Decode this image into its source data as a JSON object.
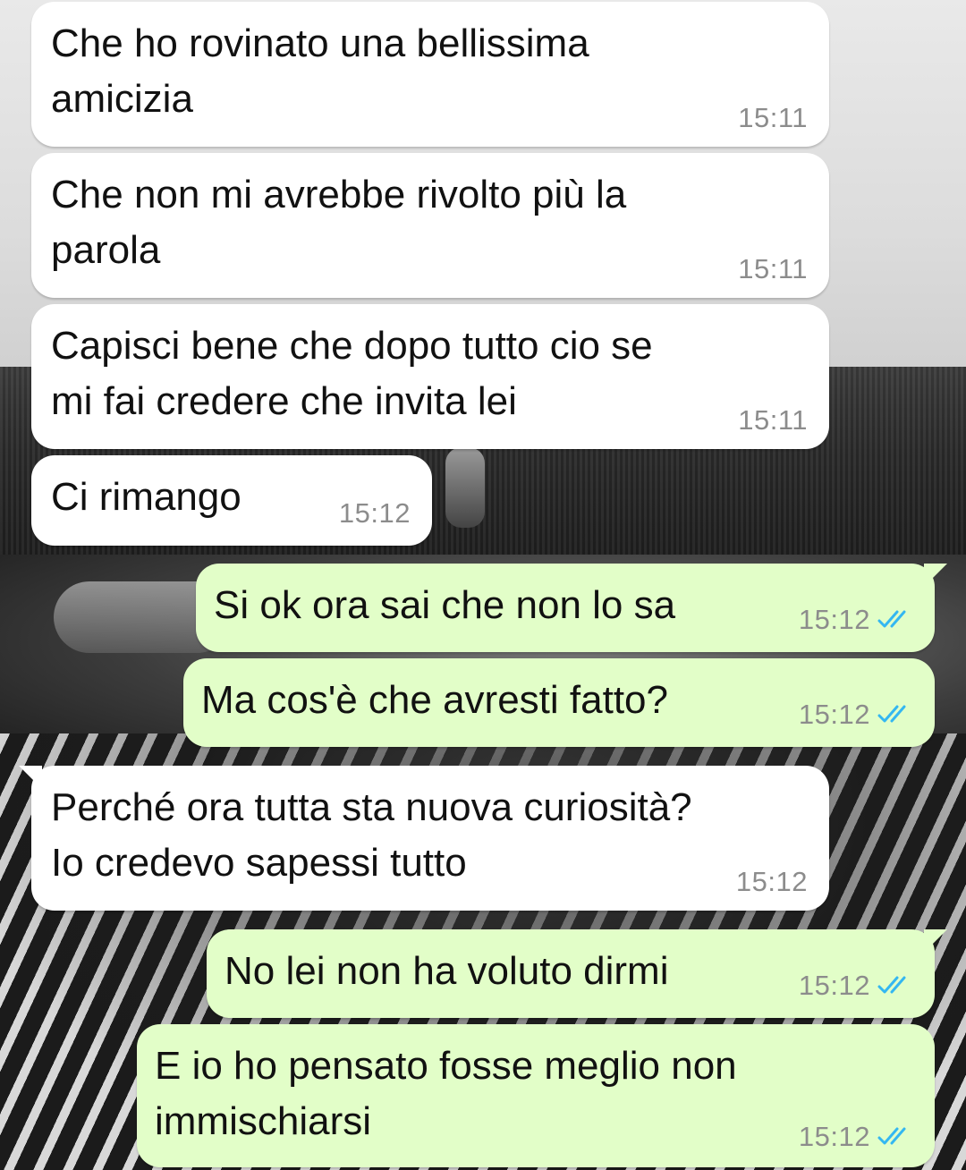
{
  "colors": {
    "incoming_bubble": "#ffffff",
    "outgoing_bubble": "#e2fec8",
    "text": "#111111",
    "timestamp": "#8c8c8c",
    "read_ticks": "#34b7f1"
  },
  "messages": [
    {
      "direction": "in",
      "text": "Che ho rovinato una bellissima\namicizia",
      "time": "15:11"
    },
    {
      "direction": "in",
      "text": "Che non mi avrebbe rivolto più la\nparola",
      "time": "15:11"
    },
    {
      "direction": "in",
      "text": "Capisci bene che dopo tutto cio se\nmi fai credere che invita lei",
      "time": "15:11"
    },
    {
      "direction": "in",
      "text": "Ci rimango",
      "time": "15:12"
    },
    {
      "direction": "out",
      "text": "Si ok ora sai che non lo sa",
      "time": "15:12",
      "status_icon": "double-check-read-icon"
    },
    {
      "direction": "out",
      "text": "Ma cos'è che avresti fatto?",
      "time": "15:12",
      "status_icon": "double-check-read-icon"
    },
    {
      "direction": "in",
      "text": "Perché ora tutta sta nuova curiosità?\nIo credevo sapessi tutto",
      "time": "15:12"
    },
    {
      "direction": "out",
      "text": "No lei non ha voluto dirmi",
      "time": "15:12",
      "status_icon": "double-check-read-icon"
    },
    {
      "direction": "out",
      "text": "E io ho pensato fosse meglio non\nimmischiarsi",
      "time": "15:12",
      "status_icon": "double-check-read-icon"
    }
  ]
}
